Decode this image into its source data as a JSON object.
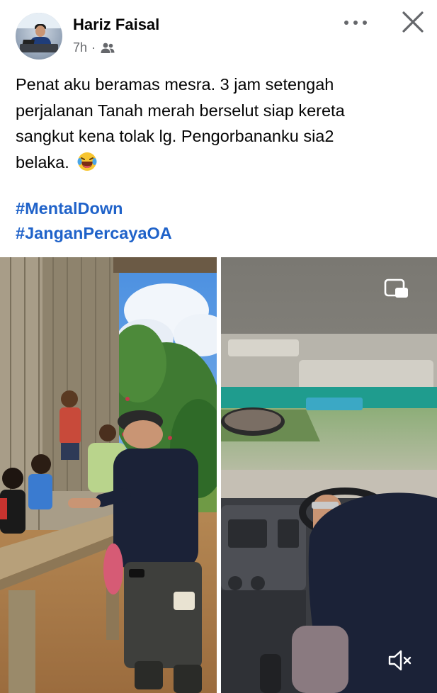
{
  "post": {
    "author": "Hariz Faisal",
    "time": "7h",
    "separator": "·",
    "audience_icon": "friends-icon",
    "text": "Penat aku beramas mesra. 3 jam setengah perjalanan Tanah merah berselut siap kereta sangkut kena tolak lg. Pengorbananku sia2 belaka.",
    "text_lines": [
      "Penat aku beramas mesra. 3 jam setengah",
      "perjalanan Tanah merah berselut siap kereta",
      "sangkut kena tolak lg. Pengorbananku sia2",
      "belaka."
    ],
    "emoji": "laughing-crying-emoji",
    "hashtags": [
      "#MentalDown",
      "#JanganPercayaOA"
    ]
  },
  "header_actions": {
    "more_icon": "more-options-icon",
    "close_icon": "close-icon"
  },
  "media": {
    "items": [
      {
        "type": "photo",
        "description_icon": "photo"
      },
      {
        "type": "video",
        "overlay_icons": [
          "picture-in-picture-icon",
          "muted-speaker-icon"
        ]
      }
    ]
  },
  "colors": {
    "name_text": "#050505",
    "meta_text": "#65676b",
    "hashtag": "#1f62c9",
    "background": "#ffffff"
  }
}
